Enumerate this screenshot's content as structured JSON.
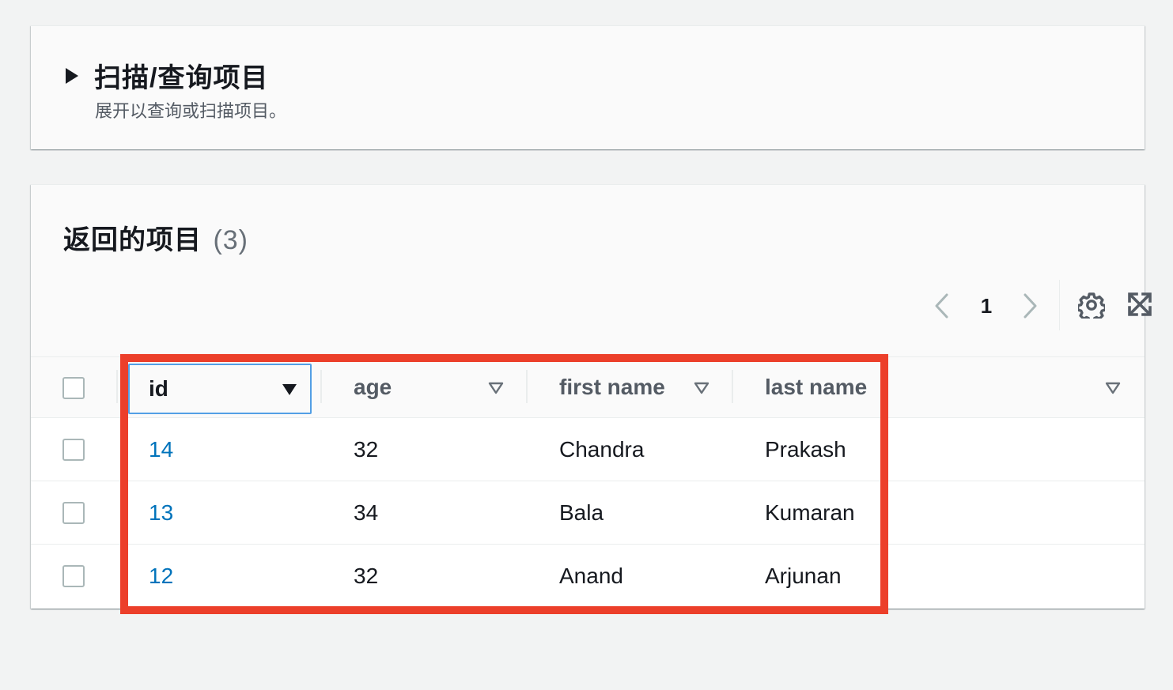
{
  "scan_panel": {
    "title": "扫描/查询项目",
    "description": "展开以查询或扫描项目。"
  },
  "items_panel": {
    "title": "返回的项目",
    "count": "(3)"
  },
  "pagination": {
    "current_page": "1"
  },
  "table": {
    "columns": [
      {
        "label": "id",
        "sorted": true
      },
      {
        "label": "age",
        "sorted": false
      },
      {
        "label": "first name",
        "sorted": false
      },
      {
        "label": "last name",
        "sorted": false
      }
    ],
    "rows": [
      {
        "id": "14",
        "age": "32",
        "first_name": "Chandra",
        "last_name": "Prakash"
      },
      {
        "id": "13",
        "age": "34",
        "first_name": "Bala",
        "last_name": "Kumaran"
      },
      {
        "id": "12",
        "age": "32",
        "first_name": "Anand",
        "last_name": "Arjunan"
      }
    ]
  },
  "colors": {
    "link": "#0073bb",
    "highlight_border": "#ec3f2a",
    "focus_border": "#539fe5"
  },
  "icons": [
    "caret-right-icon",
    "chevron-left-icon",
    "chevron-right-icon",
    "gear-icon",
    "fullscreen-icon",
    "sort-descending-icon",
    "sort-icon"
  ]
}
